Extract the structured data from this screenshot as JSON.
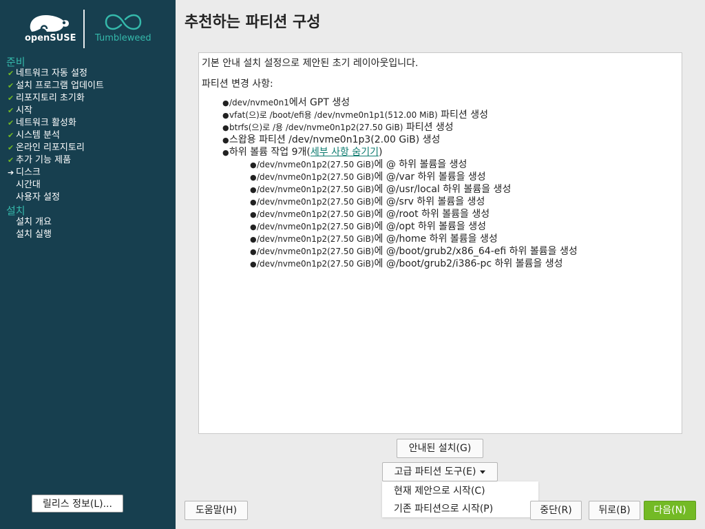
{
  "sidebar": {
    "logo": {
      "brand": "openSUSE",
      "edition": "Tumbleweed"
    },
    "sections": [
      {
        "label": "준비"
      },
      {
        "label": "설치"
      }
    ],
    "prep_steps": [
      {
        "label": "네트워크 자동 설정",
        "state": "done"
      },
      {
        "label": "설치 프로그램 업데이트",
        "state": "done"
      },
      {
        "label": "리포지토리 초기화",
        "state": "done"
      },
      {
        "label": "시작",
        "state": "done"
      },
      {
        "label": "네트워크 활성화",
        "state": "done"
      },
      {
        "label": "시스템 분석",
        "state": "done"
      },
      {
        "label": "온라인 리포지토리",
        "state": "done"
      },
      {
        "label": "추가 기능 제품",
        "state": "done"
      },
      {
        "label": "디스크",
        "state": "current"
      },
      {
        "label": "시간대",
        "state": "pending"
      },
      {
        "label": "사용자 설정",
        "state": "pending"
      }
    ],
    "install_steps": [
      {
        "label": "설치 개요"
      },
      {
        "label": "설치 실행"
      }
    ],
    "release_notes_button": "릴리스 정보(L)...",
    "check_icon": "✔",
    "arrow_icon": "➔"
  },
  "main": {
    "title": "추천하는 파티션 구성",
    "intro": "기본 안내 설치 설정으로 제안된 초기 레이아웃입니다.",
    "changes_heading": "파티션 변경 사항:",
    "changes": [
      {
        "small": "/dev/nvme0n1",
        "text": "에서 GPT 생성"
      },
      {
        "small": "vfat(으)로 /boot/efi용 /dev/nvme0n1p1(512.00 MiB)",
        "text": " 파티션 생성"
      },
      {
        "small": "btrfs(으)로 /용 /dev/nvme0n1p2(27.50 GiB)",
        "text": " 파티션 생성"
      },
      {
        "small": "",
        "text": "스왑용 파티션 /dev/nvme0n1p3(2.00 GiB) 생성"
      }
    ],
    "subvol_prefix": "하위 볼륨 작업 9개(",
    "subvol_link": "세부 사항 숨기기",
    "subvol_suffix": ")",
    "subvolumes": [
      {
        "dev": "/dev/nvme0n1p2(27.50 GiB)",
        "path": "@",
        "text": "에 @ 하위 볼륨을 생성"
      },
      {
        "dev": "/dev/nvme0n1p2(27.50 GiB)",
        "path": "@/var",
        "text": "에 @/var 하위 볼륨을 생성"
      },
      {
        "dev": "/dev/nvme0n1p2(27.50 GiB)",
        "path": "@/usr/local",
        "text": "에 @/usr/local 하위 볼륨을 생성"
      },
      {
        "dev": "/dev/nvme0n1p2(27.50 GiB)",
        "path": "@/srv",
        "text": "에 @/srv 하위 볼륨을 생성"
      },
      {
        "dev": "/dev/nvme0n1p2(27.50 GiB)",
        "path": "@/root",
        "text": "에 @/root 하위 볼륨을 생성"
      },
      {
        "dev": "/dev/nvme0n1p2(27.50 GiB)",
        "path": "@/opt",
        "text": "에 @/opt 하위 볼륨을 생성"
      },
      {
        "dev": "/dev/nvme0n1p2(27.50 GiB)",
        "path": "@/home",
        "text": "에 @/home 하위 볼륨을 생성"
      },
      {
        "dev": "/dev/nvme0n1p2(27.50 GiB)",
        "path": "@/boot/grub2/x86_64-efi",
        "text": "에 @/boot/grub2/x86_64-efi 하위 볼륨을 생성"
      },
      {
        "dev": "/dev/nvme0n1p2(27.50 GiB)",
        "path": "@/boot/grub2/i386-pc",
        "text": "에 @/boot/grub2/i386-pc 하위 볼륨을 생성"
      }
    ],
    "guided_setup_button": "안내된 설치(G)",
    "expert_partitioner_button": "고급 파티션 도구(E)",
    "expert_menu": [
      "현재 제안으로 시작(C)",
      "기존 파티션으로 시작(P)"
    ]
  },
  "footer": {
    "help": "도움말(H)",
    "abort": "중단(R)",
    "back": "뒤로(B)",
    "next": "다음(N)"
  },
  "colors": {
    "sidebar_bg": "#173f4f",
    "accent": "#35b9ab",
    "check": "#73ba25",
    "next_button": "#73ba25",
    "link": "#0b7a6e"
  }
}
